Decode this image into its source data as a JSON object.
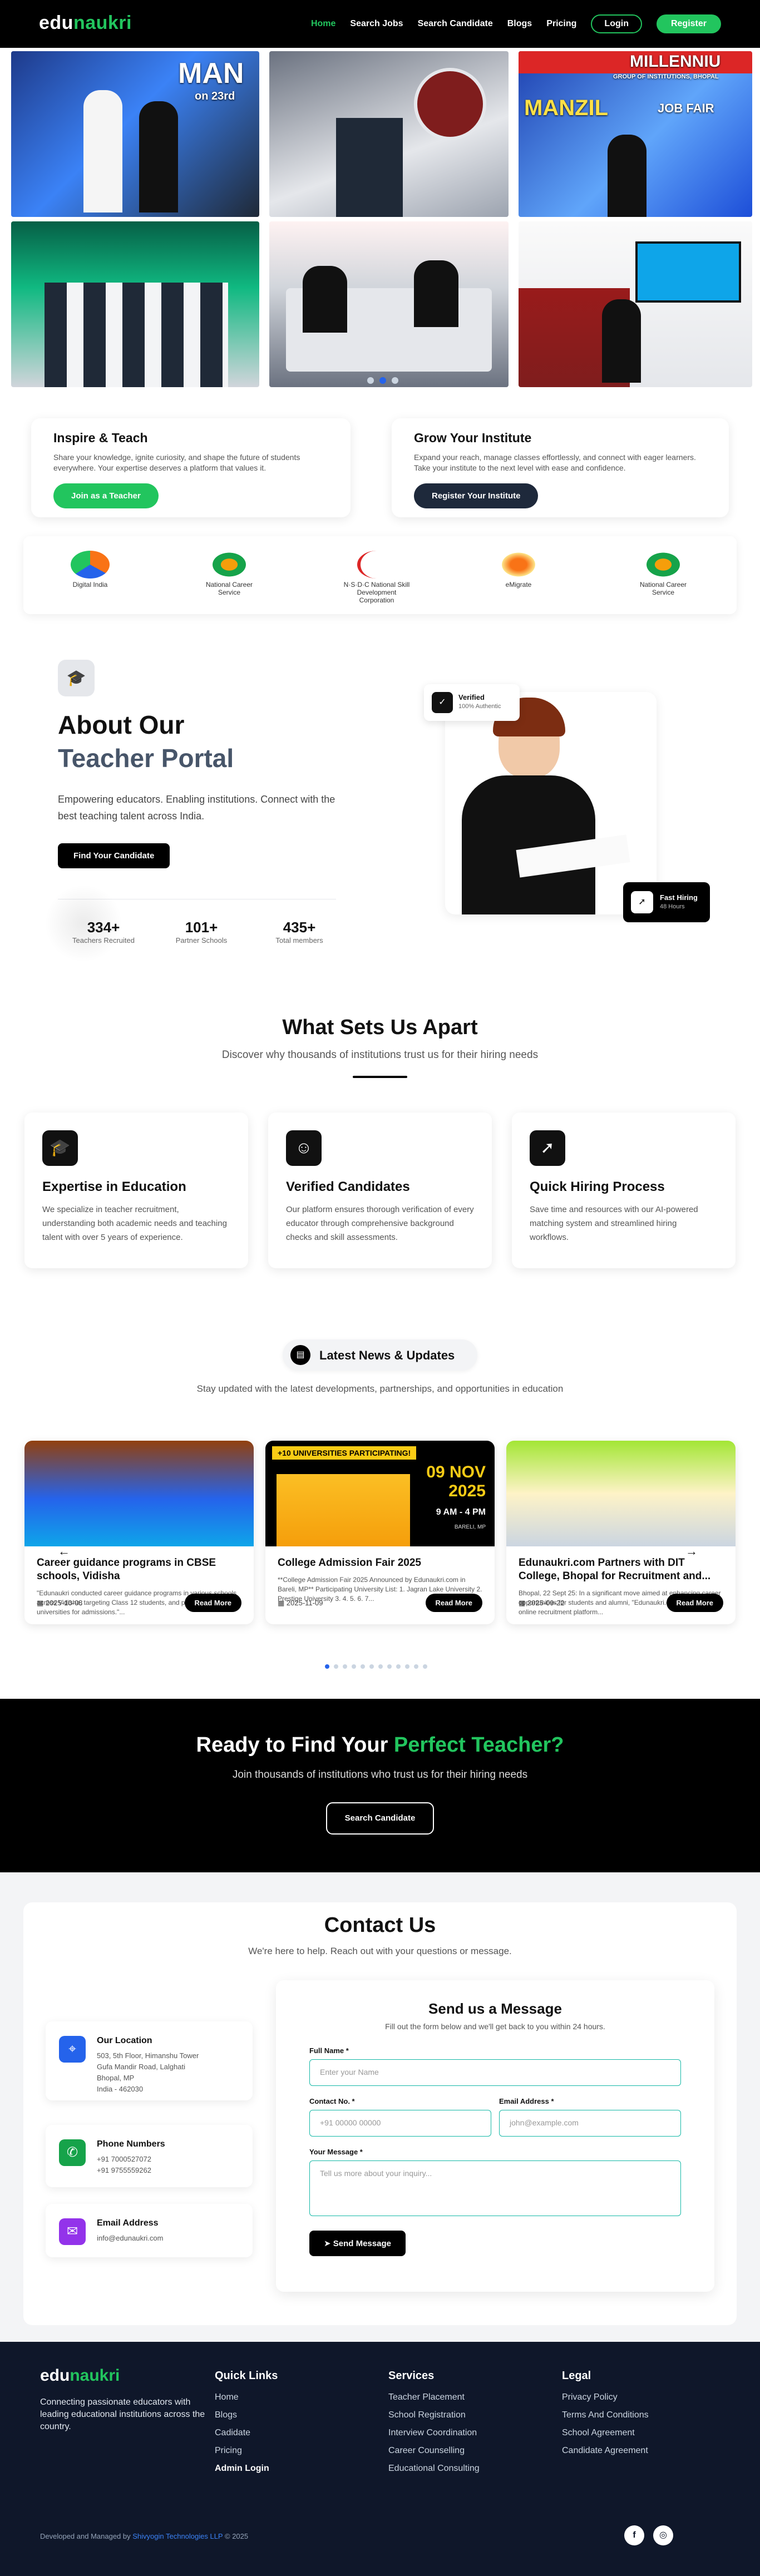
{
  "brand": {
    "part1": "edu",
    "part2": "naukri"
  },
  "nav": {
    "items": [
      "Home",
      "Search Jobs",
      "Search Candidate",
      "Blogs",
      "Pricing"
    ],
    "login": "Login",
    "register": "Register"
  },
  "gallery": {
    "captions": [
      "MAN",
      "MILLENNIU",
      "MANZIL"
    ],
    "sub": [
      "on 23rd",
      "GROUP OF INSTITUTIONS, BHOPAL",
      "JOB FAIR"
    ]
  },
  "cards": {
    "teach": {
      "title": "Inspire & Teach",
      "text": "Share your knowledge, ignite curiosity, and shape the future of students everywhere. Your expertise deserves a platform that values it.",
      "button": "Join as a Teacher"
    },
    "institute": {
      "title": "Grow Your Institute",
      "text": "Expand your reach, manage classes effortlessly, and connect with eager learners. Take your institute to the next level with ease and confidence.",
      "button": "Register Your Institute"
    }
  },
  "partners": [
    "Digital India",
    "National Career Service",
    "N·S·D·C National Skill Development Corporation",
    "eMigrate",
    "National Career Service"
  ],
  "about": {
    "title1": "About Our",
    "title2": "Teacher Portal",
    "text": "Empowering educators. Enabling institutions. Connect with the best teaching talent across India.",
    "button": "Find Your Candidate",
    "verified": "Verified",
    "verified_sub": "100% Authentic",
    "fast": "Fast Hiring",
    "fast_sub": "48 Hours",
    "stats": [
      {
        "n": "334+",
        "l": "Teachers Recruited"
      },
      {
        "n": "101+",
        "l": "Partner Schools"
      },
      {
        "n": "435+",
        "l": "Total members"
      }
    ]
  },
  "features": {
    "title": "What Sets Us Apart",
    "subtitle": "Discover why thousands of institutions trust us for their hiring needs",
    "items": [
      {
        "title": "Expertise in Education",
        "text": "We specialize in teacher recruitment, understanding both academic needs and teaching talent with over 5 years of experience."
      },
      {
        "title": "Verified Candidates",
        "text": "Our platform ensures thorough verification of every educator through comprehensive background checks and skill assessments."
      },
      {
        "title": "Quick Hiring Process",
        "text": "Save time and resources with our AI-powered matching system and streamlined hiring workflows."
      }
    ]
  },
  "news": {
    "badge": "Latest News & Updates",
    "subtitle": "Stay updated with the latest developments, partnerships, and opportunities in education",
    "items": [
      {
        "title": "Career guidance programs in CBSE schools, Vidisha",
        "text": "\"Edunaukri conducted career guidance programs in various schools across Vidisha, targeting Class 12 students, and promoted three universities for admissions.\"...",
        "date": "2025-10-08",
        "more": "Read More"
      },
      {
        "title": "College Admission Fair 2025",
        "text": "**College Admission Fair 2025 Announced by Edunaukri.com in Bareli, MP** Participating University List: 1. Jagran Lake University 2. Prestige University 3. 4. 5. 6. 7...",
        "date": "2025-11-09",
        "more": "Read More",
        "banner": "+10 UNIVERSITIES PARTICIPATING!",
        "bdate": "09 NOV 2025",
        "btime": "9 AM - 4 PM",
        "bplace": "BARELI, MP"
      },
      {
        "title": "Edunaukri.com Partners with DIT College, Bhopal for Recruitment and...",
        "text": "Bhopal, 22 Sept 25: In a significant move aimed at enhancing career opportunities for students and alumni, \"Edunaukri.com\", a leading online recruitment platform...",
        "date": "2025-09-22",
        "more": "Read More"
      }
    ]
  },
  "cta": {
    "title1": "Ready to Find Your ",
    "title2": "Perfect Teacher?",
    "text": "Join thousands of institutions who trust us for their hiring needs",
    "button": "Search Candidate"
  },
  "contact": {
    "title": "Contact Us",
    "subtitle": "We're here to help. Reach out with your questions or message.",
    "location": {
      "title": "Our Location",
      "lines": [
        "503, 5th Floor, Himanshu Tower",
        "Gufa Mandir Road, Lalghati",
        "Bhopal, MP",
        "India - 462030"
      ]
    },
    "phone": {
      "title": "Phone Numbers",
      "lines": [
        "+91 7000527072",
        "+91 9755559262"
      ]
    },
    "email": {
      "title": "Email Address",
      "lines": [
        "info@edunaukri.com"
      ]
    },
    "form": {
      "title": "Send us a Message",
      "subtitle": "Fill out the form below and we'll get back to you within 24 hours.",
      "name_label": "Full Name *",
      "name_ph": "Enter your Name",
      "contact_label": "Contact No. *",
      "contact_ph": "+91 00000 00000",
      "email_label": "Email Address *",
      "email_ph": "john@example.com",
      "msg_label": "Your Message *",
      "msg_ph": "Tell us more about your inquiry...",
      "send": "Send Message"
    }
  },
  "footer": {
    "tagline": "Connecting passionate educators with leading educational institutions across the country.",
    "quick": {
      "title": "Quick Links",
      "items": [
        "Home",
        "Blogs",
        "Cadidate",
        "Pricing",
        "Admin Login"
      ]
    },
    "services": {
      "title": "Services",
      "items": [
        "Teacher Placement",
        "School Registration",
        "Interview Coordination",
        "Career Counselling",
        "Educational Consulting"
      ]
    },
    "legal": {
      "title": "Legal",
      "items": [
        "Privacy Policy",
        "Terms And Conditions",
        "School Agreement",
        "Candidate Agreement"
      ]
    },
    "credit1": "Developed and Managed by ",
    "credit2": "Shivyogin Technologies LLP",
    "credit3": "© 2025"
  },
  "colors": {
    "accent": "#22c55e",
    "dark": "#000000",
    "navy": "#1e293b",
    "footer": "#0f172a",
    "blue": "#2563eb"
  }
}
